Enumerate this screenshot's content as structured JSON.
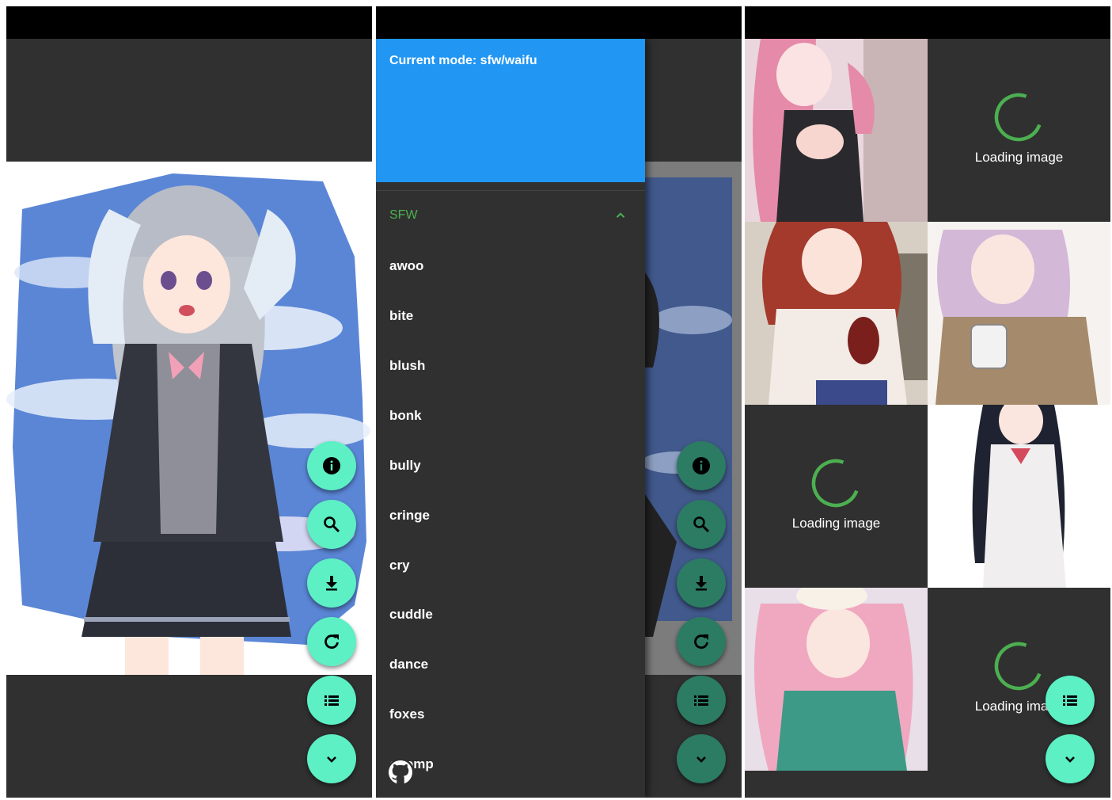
{
  "drawer": {
    "header_title": "Current mode: sfw/waifu",
    "section_title": "SFW",
    "items": [
      "awoo",
      "bite",
      "blush",
      "bonk",
      "bully",
      "cringe",
      "cry",
      "cuddle",
      "dance",
      "foxes",
      "chomp"
    ]
  },
  "fabs": [
    "info-icon",
    "search-icon",
    "download-icon",
    "refresh-icon",
    "list-icon",
    "chevron-down-icon"
  ],
  "grid": {
    "loading_label": "Loading image",
    "tiles": [
      "image",
      "loading",
      "image",
      "image",
      "loading",
      "image",
      "image",
      "loading"
    ]
  },
  "colors": {
    "accent": "#5cf0c4",
    "drawer_header": "#2196f3",
    "section_title": "#4caf50",
    "background": "#303030"
  }
}
